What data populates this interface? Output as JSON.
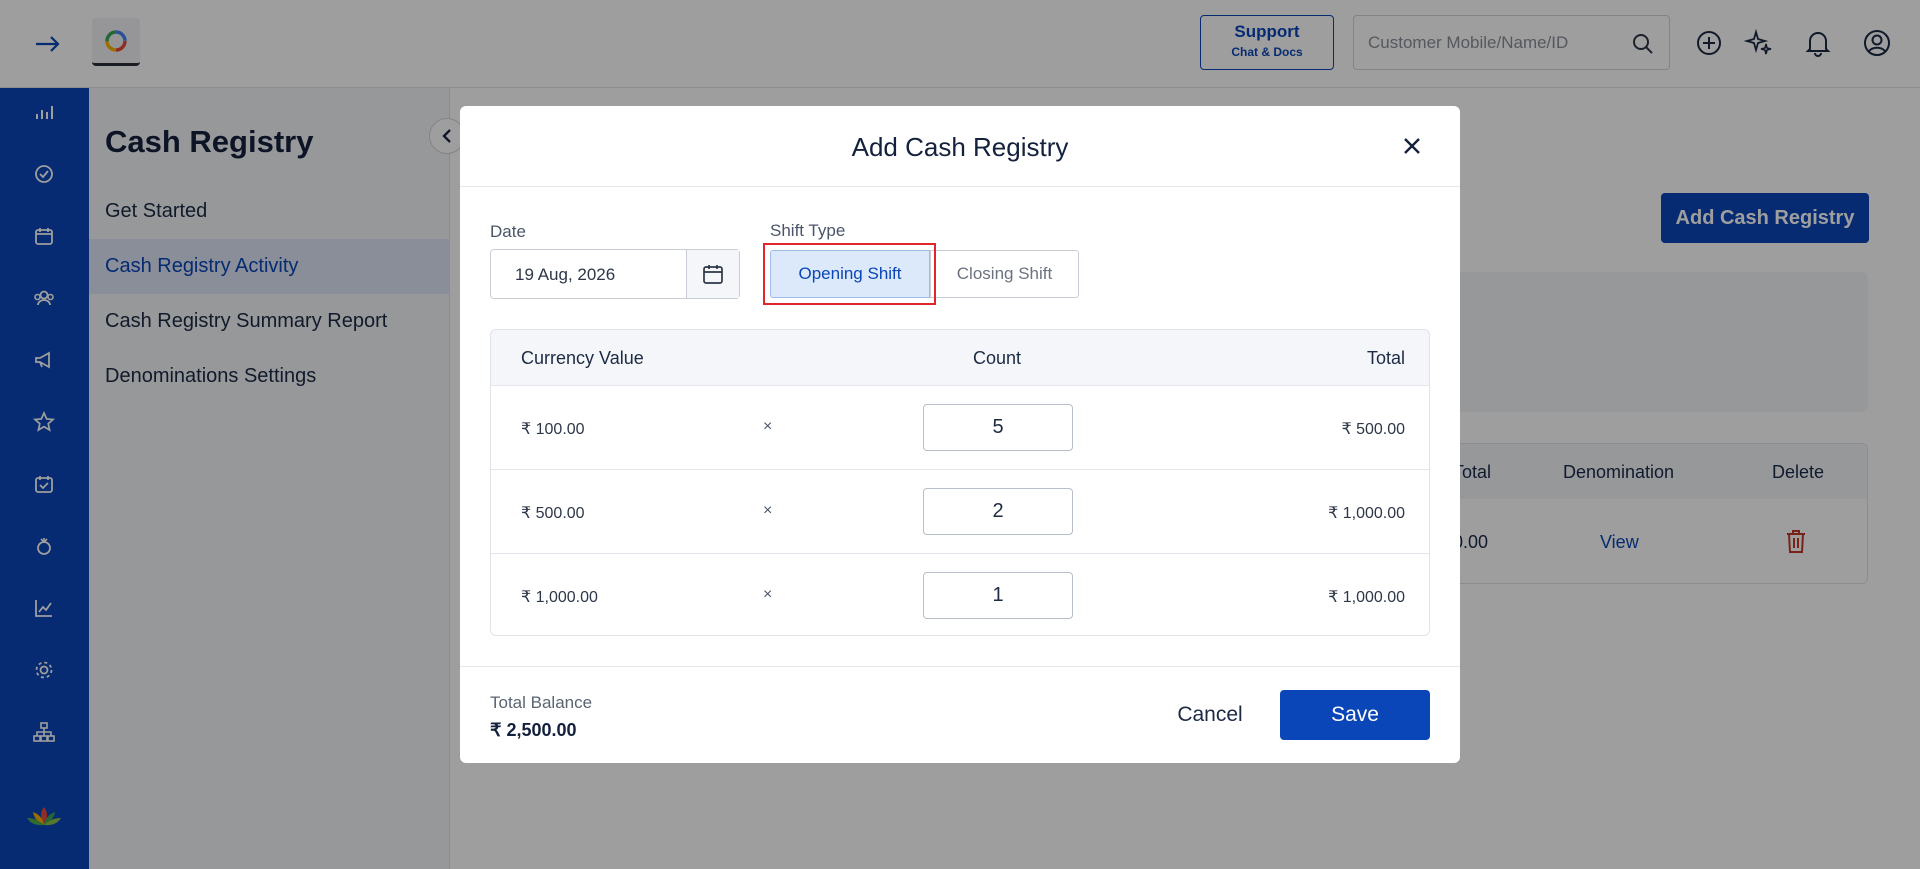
{
  "topbar": {
    "support": {
      "title": "Support",
      "subtitle": "Chat & Docs"
    },
    "search": {
      "placeholder": "Customer Mobile/Name/ID"
    },
    "icons": [
      "expand-arrow-icon",
      "app-logo",
      "search-icon",
      "add-circle-icon",
      "sparkle-icon",
      "bell-icon",
      "account-icon"
    ]
  },
  "rail": {
    "icons": [
      "analytics-icon",
      "check-circle-icon",
      "calendar-icon",
      "customers-icon",
      "megaphone-icon",
      "star-icon",
      "calendar-check-icon",
      "loyalty-icon",
      "chart-icon",
      "settings-icon",
      "org-tree-icon",
      "lotus-logo"
    ]
  },
  "subnav": {
    "title": "Cash Registry",
    "items": [
      {
        "label": "Get Started"
      },
      {
        "label": "Cash Registry Activity",
        "active": true
      },
      {
        "label": "Cash Registry Summary Report"
      },
      {
        "label": "Denominations Settings"
      }
    ]
  },
  "background": {
    "add_button": "Add Cash Registry",
    "table_headers": [
      "Total",
      "Denomination",
      "Delete"
    ],
    "row": {
      "total_fragment": "0.00",
      "view_link": "View"
    }
  },
  "modal": {
    "title": "Add Cash Registry",
    "date_label": "Date",
    "date_value": "19 Aug, 2026",
    "shift_type_label": "Shift Type",
    "shift_options": [
      "Opening Shift",
      "Closing Shift"
    ],
    "shift_selected": "Opening Shift",
    "table": {
      "headers": {
        "currency": "Currency Value",
        "count": "Count",
        "total": "Total"
      },
      "rows": [
        {
          "currency": "₹ 100.00",
          "times": "×",
          "count": "5",
          "total": "₹ 500.00"
        },
        {
          "currency": "₹ 500.00",
          "times": "×",
          "count": "2",
          "total": "₹ 1,000.00"
        },
        {
          "currency": "₹ 1,000.00",
          "times": "×",
          "count": "1",
          "total": "₹ 1,000.00"
        }
      ]
    },
    "total_balance_label": "Total Balance",
    "total_balance_value": "₹ 2,500.00",
    "cancel": "Cancel",
    "save": "Save"
  },
  "colors": {
    "brand_blue": "#0a46b8",
    "highlight_red": "#e0262b",
    "delete_red": "#c0392b"
  }
}
